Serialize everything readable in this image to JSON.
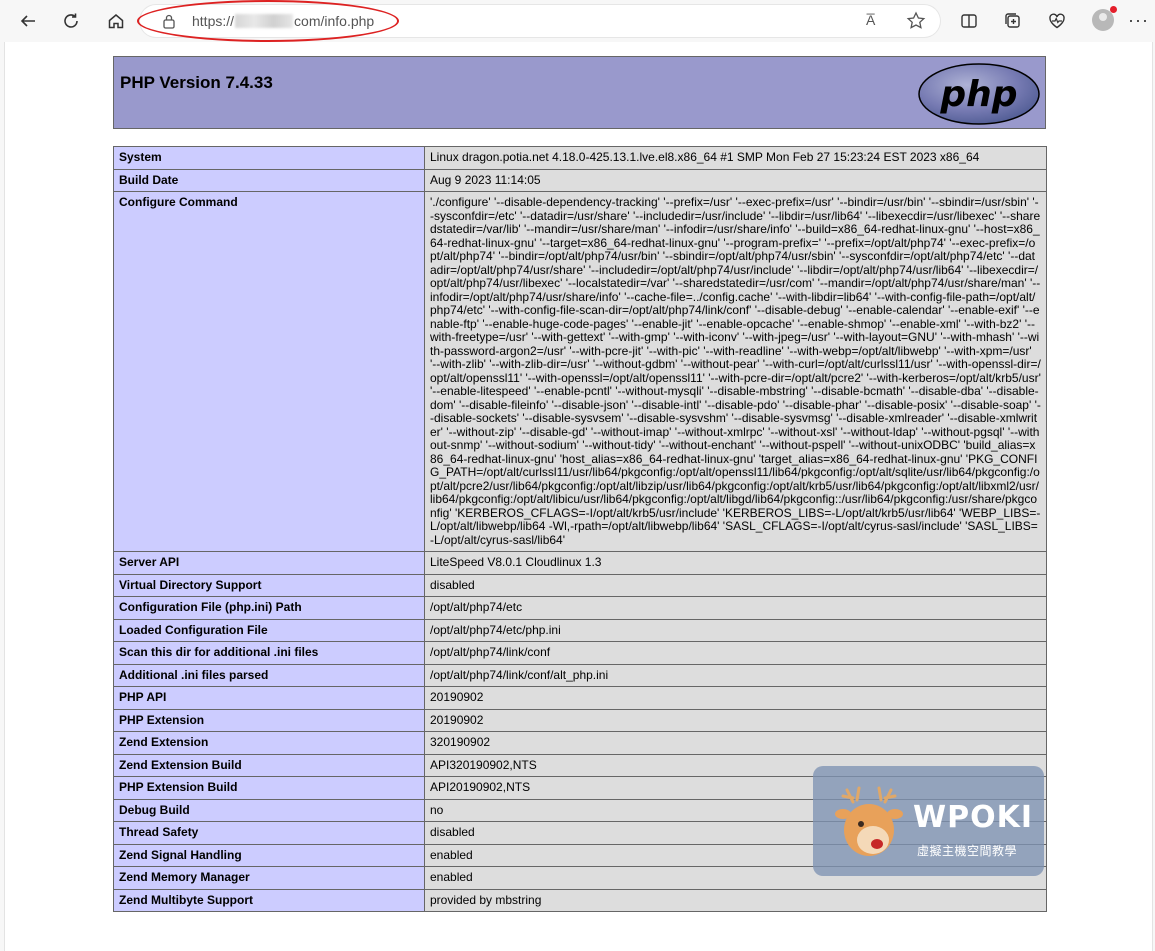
{
  "browser": {
    "url_prefix": "https://",
    "url_suffix": "com/info.php",
    "read_aloud_label": "A̅",
    "more_label": "···"
  },
  "page": {
    "title": "PHP Version 7.4.33",
    "logo_text": "php"
  },
  "rows": [
    {
      "key": "System",
      "value": "Linux dragon.potia.net 4.18.0-425.13.1.lve.el8.x86_64 #1 SMP Mon Feb 27 15:23:24 EST 2023 x86_64"
    },
    {
      "key": "Build Date",
      "value": "Aug 9 2023 11:14:05"
    },
    {
      "key": "Configure Command",
      "value": "'./configure' '--disable-dependency-tracking' '--prefix=/usr' '--exec-prefix=/usr' '--bindir=/usr/bin' '--sbindir=/usr/sbin' '--sysconfdir=/etc' '--datadir=/usr/share' '--includedir=/usr/include' '--libdir=/usr/lib64' '--libexecdir=/usr/libexec' '--sharedstatedir=/var/lib' '--mandir=/usr/share/man' '--infodir=/usr/share/info' '--build=x86_64-redhat-linux-gnu' '--host=x86_64-redhat-linux-gnu' '--target=x86_64-redhat-linux-gnu' '--program-prefix=' '--prefix=/opt/alt/php74' '--exec-prefix=/opt/alt/php74' '--bindir=/opt/alt/php74/usr/bin' '--sbindir=/opt/alt/php74/usr/sbin' '--sysconfdir=/opt/alt/php74/etc' '--datadir=/opt/alt/php74/usr/share' '--includedir=/opt/alt/php74/usr/include' '--libdir=/opt/alt/php74/usr/lib64' '--libexecdir=/opt/alt/php74/usr/libexec' '--localstatedir=/var' '--sharedstatedir=/usr/com' '--mandir=/opt/alt/php74/usr/share/man' '--infodir=/opt/alt/php74/usr/share/info' '--cache-file=../config.cache' '--with-libdir=lib64' '--with-config-file-path=/opt/alt/php74/etc' '--with-config-file-scan-dir=/opt/alt/php74/link/conf' '--disable-debug' '--enable-calendar' '--enable-exif' '--enable-ftp' '--enable-huge-code-pages' '--enable-jit' '--enable-opcache' '--enable-shmop' '--enable-xml' '--with-bz2' '--with-freetype=/usr' '--with-gettext' '--with-gmp' '--with-iconv' '--with-jpeg=/usr' '--with-layout=GNU' '--with-mhash' '--with-password-argon2=/usr' '--with-pcre-jit' '--with-pic' '--with-readline' '--with-webp=/opt/alt/libwebp' '--with-xpm=/usr' '--with-zlib' '--with-zlib-dir=/usr' '--without-gdbm' '--without-pear' '--with-curl=/opt/alt/curlssl11/usr' '--with-openssl-dir=/opt/alt/openssl11' '--with-openssl=/opt/alt/openssl11' '--with-pcre-dir=/opt/alt/pcre2' '--with-kerberos=/opt/alt/krb5/usr' '--enable-litespeed' '--enable-pcntl' '--without-mysqli' '--disable-mbstring' '--disable-bcmath' '--disable-dba' '--disable-dom' '--disable-fileinfo' '--disable-json' '--disable-intl' '--disable-pdo' '--disable-phar' '--disable-posix' '--disable-soap' '--disable-sockets' '--disable-sysvsem' '--disable-sysvshm' '--disable-sysvmsg' '--disable-xmlreader' '--disable-xmlwriter' '--without-zip' '--disable-gd' '--without-imap' '--without-xmlrpc' '--without-xsl' '--without-ldap' '--without-pgsql' '--without-snmp' '--without-sodium' '--without-tidy' '--without-enchant' '--without-pspell' '--without-unixODBC' 'build_alias=x86_64-redhat-linux-gnu' 'host_alias=x86_64-redhat-linux-gnu' 'target_alias=x86_64-redhat-linux-gnu' 'PKG_CONFIG_PATH=/opt/alt/curlssl11/usr/lib64/pkgconfig:/opt/alt/openssl11/lib64/pkgconfig:/opt/alt/sqlite/usr/lib64/pkgconfig:/opt/alt/pcre2/usr/lib64/pkgconfig:/opt/alt/libzip/usr/lib64/pkgconfig:/opt/alt/krb5/usr/lib64/pkgconfig:/opt/alt/libxml2/usr/lib64/pkgconfig:/opt/alt/libicu/usr/lib64/pkgconfig:/opt/alt/libgd/lib64/pkgconfig::/usr/lib64/pkgconfig:/usr/share/pkgconfig' 'KERBEROS_CFLAGS=-I/opt/alt/krb5/usr/include' 'KERBEROS_LIBS=-L/opt/alt/krb5/usr/lib64' 'WEBP_LIBS=-L/opt/alt/libwebp/lib64 -Wl,-rpath=/opt/alt/libwebp/lib64' 'SASL_CFLAGS=-I/opt/alt/cyrus-sasl/include' 'SASL_LIBS=-L/opt/alt/cyrus-sasl/lib64'"
    },
    {
      "key": "Server API",
      "value": "LiteSpeed V8.0.1 Cloudlinux 1.3"
    },
    {
      "key": "Virtual Directory Support",
      "value": "disabled"
    },
    {
      "key": "Configuration File (php.ini) Path",
      "value": "/opt/alt/php74/etc"
    },
    {
      "key": "Loaded Configuration File",
      "value": "/opt/alt/php74/etc/php.ini"
    },
    {
      "key": "Scan this dir for additional .ini files",
      "value": "/opt/alt/php74/link/conf"
    },
    {
      "key": "Additional .ini files parsed",
      "value": "/opt/alt/php74/link/conf/alt_php.ini"
    },
    {
      "key": "PHP API",
      "value": "20190902"
    },
    {
      "key": "PHP Extension",
      "value": "20190902"
    },
    {
      "key": "Zend Extension",
      "value": "320190902"
    },
    {
      "key": "Zend Extension Build",
      "value": "API320190902,NTS"
    },
    {
      "key": "PHP Extension Build",
      "value": "API20190902,NTS"
    },
    {
      "key": "Debug Build",
      "value": "no"
    },
    {
      "key": "Thread Safety",
      "value": "disabled"
    },
    {
      "key": "Zend Signal Handling",
      "value": "enabled"
    },
    {
      "key": "Zend Memory Manager",
      "value": "enabled"
    },
    {
      "key": "Zend Multibyte Support",
      "value": "provided by mbstring"
    }
  ],
  "watermark": {
    "title": "WPOKI",
    "subtitle": "虛擬主機空間教學"
  }
}
